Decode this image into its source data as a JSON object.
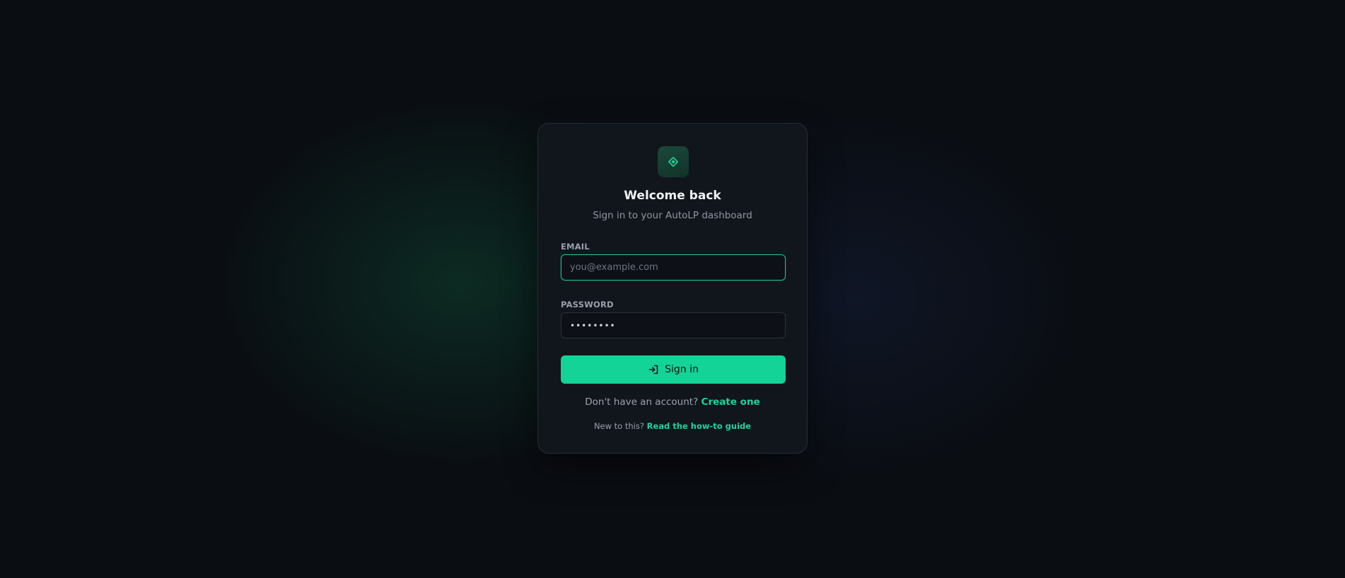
{
  "brand": {
    "logo_icon": "diamond-icon",
    "accent_color": "#14d396"
  },
  "header": {
    "title": "Welcome back",
    "subtitle": "Sign in to your AutoLP dashboard"
  },
  "form": {
    "email": {
      "label": "EMAIL",
      "placeholder": "you@example.com",
      "value": ""
    },
    "password": {
      "label": "PASSWORD",
      "value": "••••••••"
    },
    "submit": {
      "label": "Sign in",
      "icon": "log-in-icon"
    }
  },
  "footer": {
    "signup_prompt": "Don't have an account?",
    "signup_link": "Create one",
    "guide_prompt": "New to this?",
    "guide_link": "Read the how-to guide"
  }
}
